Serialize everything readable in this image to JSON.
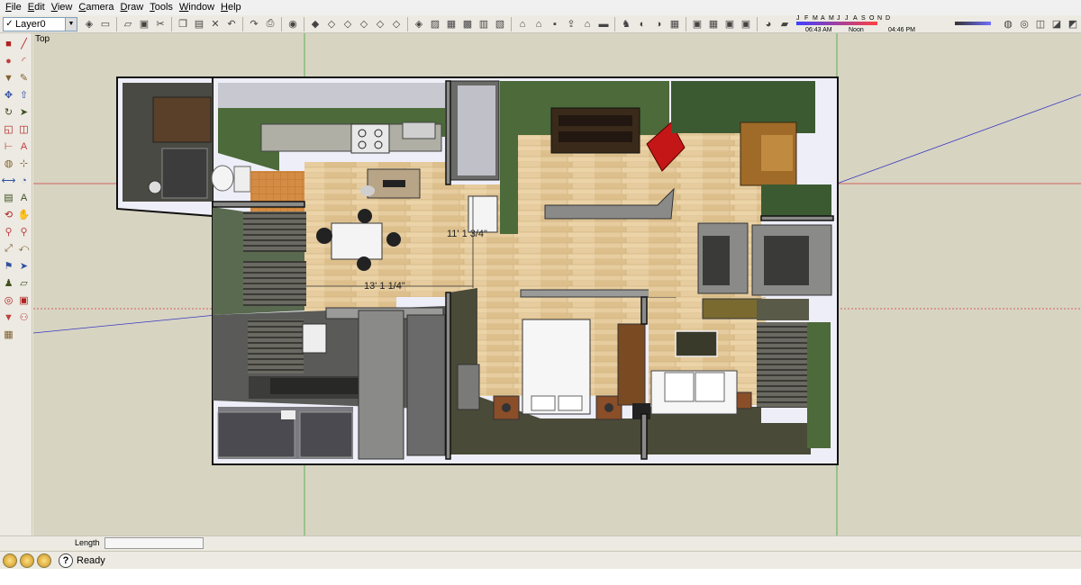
{
  "menu": [
    "File",
    "Edit",
    "View",
    "Camera",
    "Draw",
    "Tools",
    "Window",
    "Help"
  ],
  "toolbar": {
    "layer_check": "✓",
    "layer_value": "Layer0",
    "icons": [
      "layer-manager-icon",
      "select-icon",
      "eraser-icon",
      "save-icon",
      "cut-icon",
      "copy-icon",
      "paste-icon",
      "delete-icon",
      "undo-icon",
      "redo-icon",
      "print-icon",
      "model-info-icon",
      "iso-view-icon",
      "top-view-icon",
      "front-view-icon",
      "right-view-icon",
      "back-view-icon",
      "left-view-icon",
      "xray-icon",
      "wireframe-icon",
      "hidden-line-icon",
      "shaded-icon",
      "textured-icon",
      "monochrome-icon",
      "dealer-icon",
      "warehouse-icon",
      "component-icon",
      "share-icon",
      "house-icon",
      "section-icon",
      "walk-icon",
      "look-icon",
      "position-camera-icon",
      "sandbox-icon",
      "add-location-icon",
      "terrain-icon",
      "photo-icon",
      "snapshot-icon",
      "shadows-toggle-icon",
      "fog-icon"
    ],
    "right_icons": [
      "paint-bucket-icon",
      "follow-me-icon",
      "offset-icon",
      "scale-icon",
      "tape-icon"
    ]
  },
  "shadow_settings": {
    "months": [
      "J",
      "F",
      "M",
      "A",
      "M",
      "J",
      "J",
      "A",
      "S",
      "O",
      "N",
      "D"
    ],
    "time_start": "06:43 AM",
    "time_mid": "Noon",
    "time_end": "04:46 PM"
  },
  "palette_tools": [
    "rectangle-tool",
    "line-tool",
    "circle-tool",
    "arc-tool",
    "polygon-tool",
    "freehand-tool",
    "move-tool",
    "push-pull-tool",
    "rotate-tool",
    "follow-me-tool",
    "scale-tool",
    "offset-tool",
    "tape-measure-tool",
    "text-tool",
    "paint-tool",
    "axes-tool",
    "dimension-tool",
    "protractor-tool",
    "section-tool",
    "3d-text-tool",
    "orbit-tool",
    "pan-tool",
    "zoom-tool",
    "zoom-window-tool",
    "zoom-extents-tool",
    "previous-view-tool",
    "position-camera-tool",
    "select-tool",
    "walk-tool",
    "eraser-tool",
    "look-around-tool",
    "component-tool",
    "paint-bucket-tool",
    "footprint-tool",
    "sandbox-tool"
  ],
  "viewport": {
    "view_label": "Top",
    "dimension_1": "11' 1 3/4\"",
    "dimension_2": "13' 1 1/4\""
  },
  "measurements": {
    "label": "Length",
    "value": ""
  },
  "status": {
    "text": "Ready"
  },
  "colors": {
    "viewport_bg": "#d7d4c2",
    "wall": "#6b6b6b",
    "floor": "#e3c89a",
    "green_wall": "#4c6a3a",
    "red_axis": "#d02020",
    "blue_axis": "#2020c0",
    "green_axis": "#20a020"
  }
}
